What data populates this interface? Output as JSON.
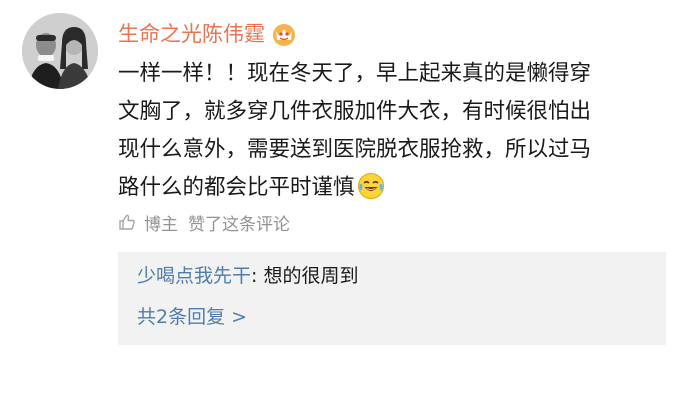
{
  "comment": {
    "author_name": "生命之光陈伟霆",
    "author_badge_icon": "vip-crown-badge-icon",
    "text_lines": [
      "一样一样！！现在冬天了，早上起来真的是懒得穿",
      "文胸了，就多穿几件衣服加件大衣，有时候很怕出",
      "现什么意外，需要送到医院脱衣服抢救，所以过马",
      "路什么的都会比平时谨慎"
    ],
    "trailing_emoji": "laughing-tears-emoji-icon"
  },
  "like": {
    "icon": "thumb-up-icon",
    "author_label": "博主",
    "text": "赞了这条评论"
  },
  "replies": {
    "first_reply": {
      "user": "少喝点我先干",
      "separator": ":",
      "content": " 想的很周到"
    },
    "more_label": "共2条回复 >"
  },
  "colors": {
    "author_name": "#eb7350",
    "link_blue": "#507daf",
    "muted_gray": "#939393",
    "reply_bg": "#f2f2f2"
  }
}
